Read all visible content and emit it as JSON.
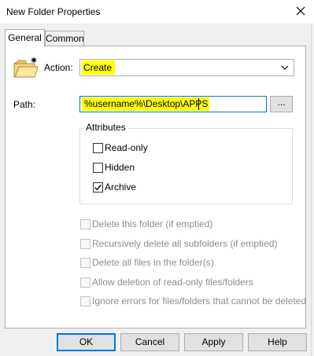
{
  "window": {
    "title": "New Folder Properties"
  },
  "tabs": [
    {
      "label": "General",
      "active": true
    },
    {
      "label": "Common",
      "active": false
    }
  ],
  "action": {
    "label": "Action:",
    "value": "Create"
  },
  "path": {
    "label": "Path:",
    "value": "%username%\\Desktop\\APPS",
    "browse_label": "..."
  },
  "attributes": {
    "legend": "Attributes",
    "items": [
      {
        "label": "Read-only",
        "checked": false
      },
      {
        "label": "Hidden",
        "checked": false
      },
      {
        "label": "Archive",
        "checked": true
      }
    ]
  },
  "options": [
    {
      "label": "Delete this folder (if emptied)",
      "checked": false,
      "enabled": false
    },
    {
      "label": "Recursively delete all subfolders (if emptied)",
      "checked": false,
      "enabled": false
    },
    {
      "label": "Delete all files in the folder(s)",
      "checked": false,
      "enabled": false
    },
    {
      "label": "Allow deletion of read-only files/folders",
      "checked": false,
      "enabled": false
    },
    {
      "label": "Ignore errors for files/folders that cannot be deleted",
      "checked": false,
      "enabled": false
    }
  ],
  "buttons": {
    "ok": "OK",
    "cancel": "Cancel",
    "apply": "Apply",
    "help": "Help"
  },
  "colors": {
    "highlight": "#ffff00",
    "focus": "#0078d7"
  },
  "icons": {
    "folder": "new-folder-icon",
    "close": "close-icon",
    "dropdown": "chevron-down-icon"
  }
}
